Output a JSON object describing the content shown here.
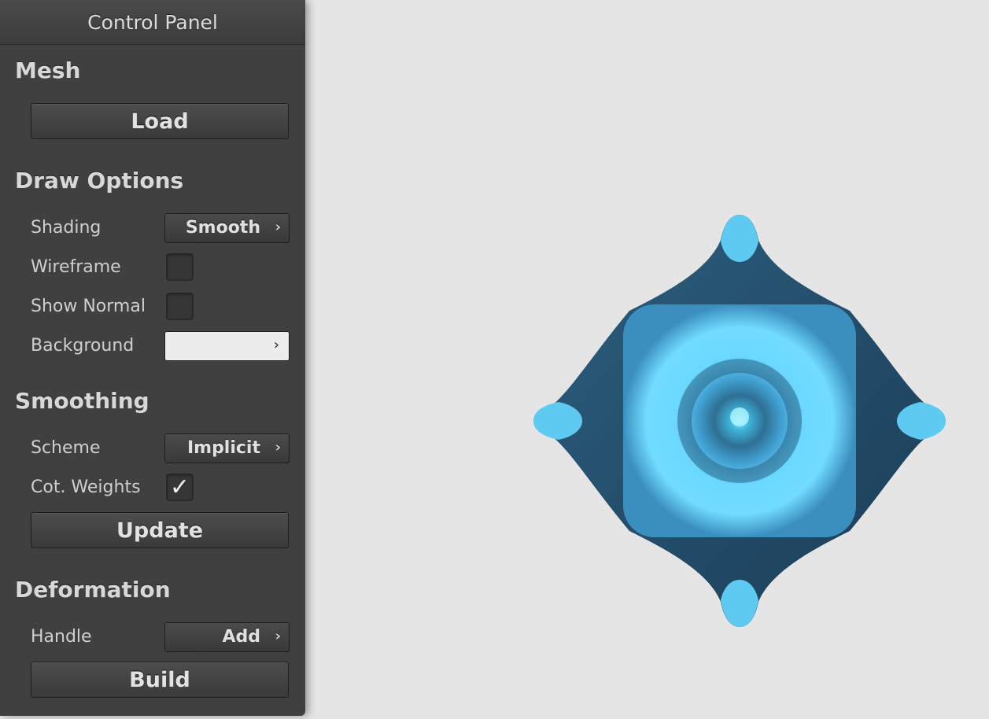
{
  "panel": {
    "title": "Control Panel"
  },
  "mesh": {
    "title": "Mesh",
    "load_label": "Load"
  },
  "draw_options": {
    "title": "Draw Options",
    "shading_label": "Shading",
    "shading_value": "Smooth",
    "wireframe_label": "Wireframe",
    "wireframe_checked": false,
    "show_normal_label": "Show Normal",
    "show_normal_checked": false,
    "background_label": "Background",
    "background_color": "#ececec"
  },
  "smoothing": {
    "title": "Smoothing",
    "scheme_label": "Scheme",
    "scheme_value": "Implicit",
    "cot_weights_label": "Cot. Weights",
    "cot_weights_checked": true,
    "update_label": "Update"
  },
  "deformation": {
    "title": "Deformation",
    "handle_label": "Handle",
    "handle_value": "Add",
    "build_label": "Build"
  },
  "icons": {
    "combo_chevron": "chevron-right-icon",
    "checkmark": "checkmark-icon"
  },
  "colors": {
    "mesh": "#6ad8ff",
    "mesh_shadow": "#1f4a66",
    "viewport_bg": "#e5e5e5",
    "panel_bg": "#404040"
  }
}
